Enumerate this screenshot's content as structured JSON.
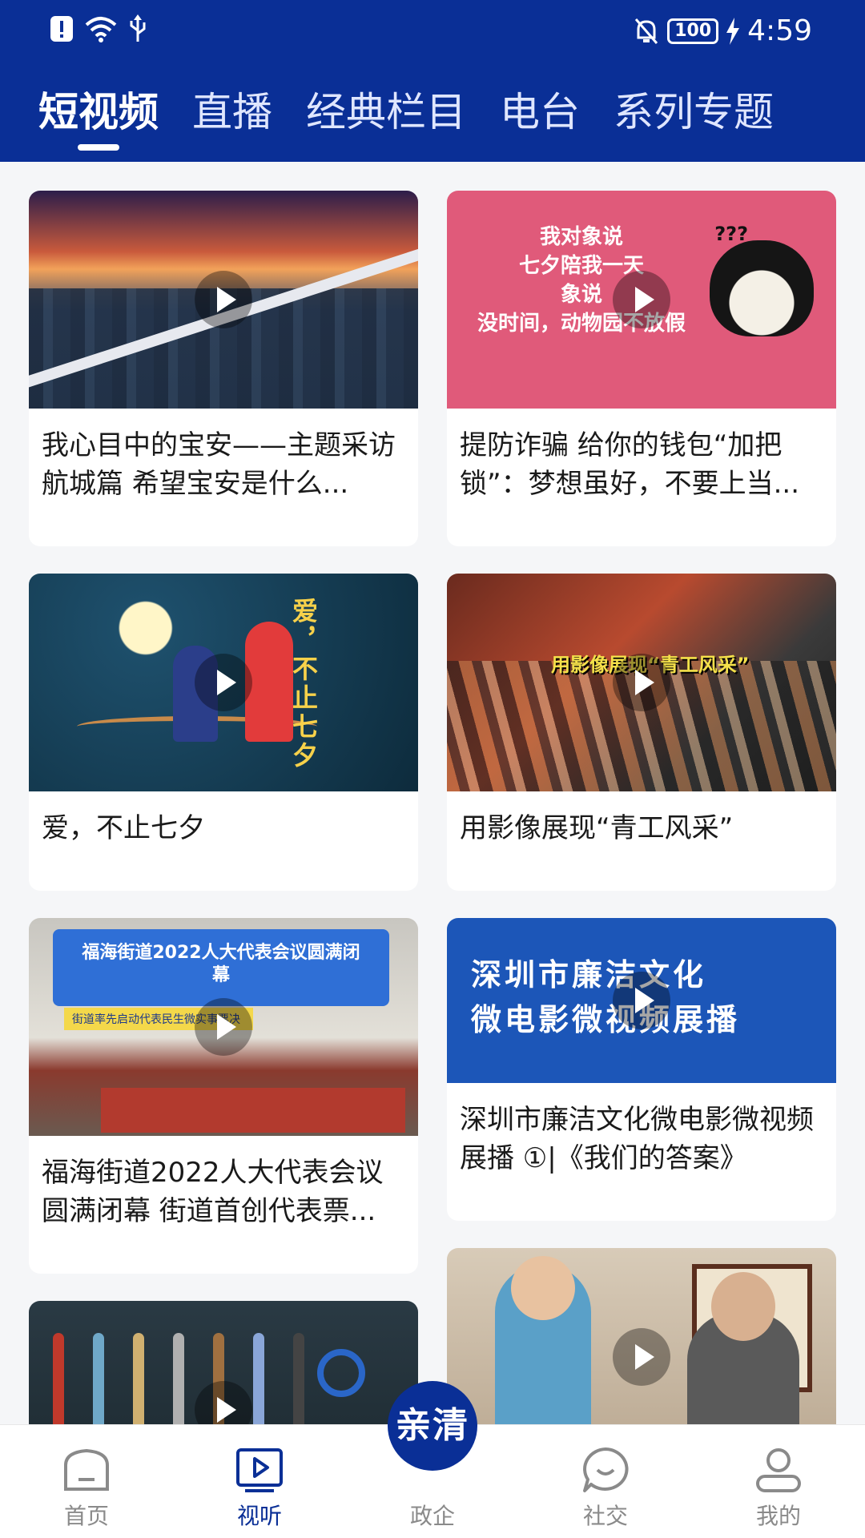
{
  "status_bar": {
    "battery": "100",
    "time": "4:59",
    "icons": [
      "alert-icon",
      "wifi-icon",
      "usb-icon",
      "mute-bell-icon",
      "battery-icon",
      "charging-icon"
    ]
  },
  "tabs": [
    {
      "label": "短视频",
      "active": true
    },
    {
      "label": "直播",
      "active": false
    },
    {
      "label": "经典栏目",
      "active": false
    },
    {
      "label": "电台",
      "active": false
    },
    {
      "label": "系列专题",
      "active": false
    }
  ],
  "cards": [
    {
      "title": "我心目中的宝安——主题采访航城篇  希望宝安是什么..."
    },
    {
      "title": "提防诈骗 给你的钱包“加把锁”：梦想虽好，不要上当..."
    },
    {
      "title": "爱，不止七夕"
    },
    {
      "title": "用影像展现“青工风采”"
    },
    {
      "title": "福海街道2022人大代表会议圆满闭幕 街道首创代表票..."
    },
    {
      "title": "深圳市廉洁文化微电影微视频展播 ①|《我们的答案》"
    },
    {
      "title": ""
    },
    {
      "title": ""
    }
  ],
  "thumb_text": {
    "card2_lines": "我对象说\n七夕陪我一天\n象说\n没时间，动物园不放假",
    "card2_q": "???",
    "card3_vertical": "爱，不止七夕",
    "card4_caption": "用影像展现“青工风采”",
    "card5_banner": "福海街道2022人大代表会议圆满闭幕",
    "card5_sub": "街道率先启动代表民生微实事票决",
    "card6_line1": "深圳市廉洁文化",
    "card6_line2": "微电影微视频展播"
  },
  "bottom_nav": [
    {
      "label": "首页",
      "icon": "home-icon",
      "active": false
    },
    {
      "label": "视听",
      "icon": "video-play-icon",
      "active": true
    },
    {
      "label": "政企",
      "icon": "qinqing-logo",
      "active": false
    },
    {
      "label": "社交",
      "icon": "chat-bubble-icon",
      "active": false
    },
    {
      "label": "我的",
      "icon": "user-icon",
      "active": false
    }
  ],
  "center_button": "亲清",
  "colors": {
    "brand": "#0a2f96",
    "inactive": "#8a8a8a"
  }
}
